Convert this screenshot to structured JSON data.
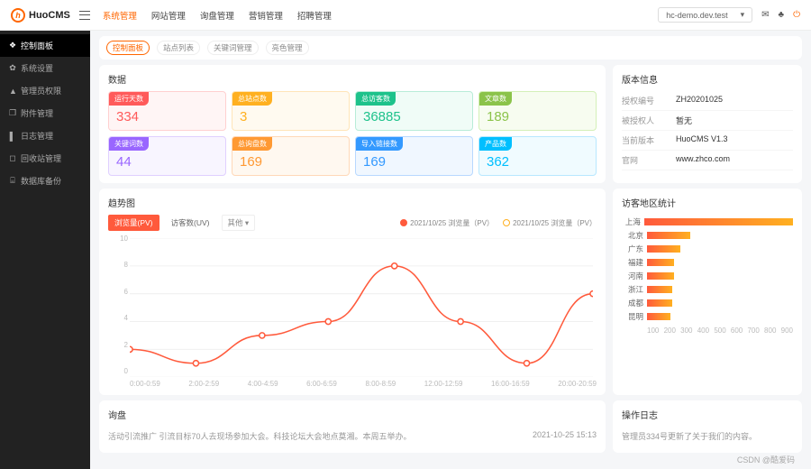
{
  "brand": "HuoCMS",
  "topnav": [
    "系统管理",
    "网站管理",
    "询盘管理",
    "营销管理",
    "招聘管理"
  ],
  "topnav_active": 0,
  "env": "hc-demo.dev.test",
  "side": [
    {
      "icon": "❖",
      "label": "控制面板"
    },
    {
      "icon": "✿",
      "label": "系统设置"
    },
    {
      "icon": "▲",
      "label": "管理员权限"
    },
    {
      "icon": "❐",
      "label": "附件管理"
    },
    {
      "icon": "▌",
      "label": "日志管理"
    },
    {
      "icon": "◻",
      "label": "回收站管理"
    },
    {
      "icon": "⌸",
      "label": "数据库备份"
    }
  ],
  "side_active": 0,
  "crumbs": [
    "控制面板",
    "站点列表",
    "关键词管理",
    "亮色管理"
  ],
  "crumb_active": 0,
  "panels": {
    "data": "数据",
    "version": "版本信息",
    "trend": "趋势图",
    "region": "访客地区统计",
    "inquiry": "询盘",
    "oplog": "操作日志"
  },
  "stats": [
    {
      "cls": "s-r",
      "label": "运行天数",
      "value": "334"
    },
    {
      "cls": "s-y",
      "label": "总站点数",
      "value": "3"
    },
    {
      "cls": "s-g",
      "label": "总访客数",
      "value": "36885"
    },
    {
      "cls": "s-l",
      "label": "文章数",
      "value": "189"
    },
    {
      "cls": "s-p",
      "label": "关键词数",
      "value": "44"
    },
    {
      "cls": "s-o",
      "label": "总询盘数",
      "value": "169"
    },
    {
      "cls": "s-b",
      "label": "导入链接数",
      "value": "169"
    },
    {
      "cls": "s-c",
      "label": "产品数",
      "value": "362"
    }
  ],
  "version": [
    {
      "k": "授权编号",
      "v": "ZH20201025"
    },
    {
      "k": "被授权人",
      "v": "暂无"
    },
    {
      "k": "当前版本",
      "v": "HuoCMS V1.3"
    },
    {
      "k": "官网",
      "v": "www.zhco.com"
    }
  ],
  "trend_tabs": [
    "浏览量(PV)",
    "访客数(UV)"
  ],
  "trend_tabs_active": 0,
  "trend_other": "其他 ▾",
  "trend_legend": [
    "2021/10/25 浏览量（PV）",
    "2021/10/25 浏览量（PV）"
  ],
  "chart_data": {
    "type": "line",
    "title": "",
    "xlabel": "",
    "ylabel": "",
    "categories": [
      "0:00-0:59",
      "2:00-2:59",
      "4:00-4:59",
      "6:00-6:59",
      "8:00-8:59",
      "12:00-12:59",
      "16:00-16:59",
      "20:00-20:59"
    ],
    "ylim": [
      0,
      10
    ],
    "yticks": [
      0,
      2,
      4,
      6,
      8,
      10
    ],
    "series": [
      {
        "name": "2021/10/25 浏览量（PV）",
        "values": [
          2,
          1,
          3,
          4,
          8,
          4,
          1,
          6
        ]
      }
    ]
  },
  "region": {
    "labels": [
      "上海",
      "北京",
      "广东",
      "福建",
      "河南",
      "浙江",
      "成都",
      "昆明"
    ],
    "values": [
      880,
      220,
      170,
      140,
      140,
      130,
      130,
      120
    ],
    "xticks": [
      100,
      200,
      300,
      400,
      500,
      600,
      700,
      800,
      900
    ]
  },
  "inquiry": {
    "text": "活动引流推广 引流目标70人去现场参加大会。科技论坛大会地点莫湘。本周五举办。",
    "time": "2021-10-25 15:13"
  },
  "oplog": {
    "text": "管理员334号更新了关于我们的内容。"
  },
  "watermark": "CSDN @酷爱码"
}
